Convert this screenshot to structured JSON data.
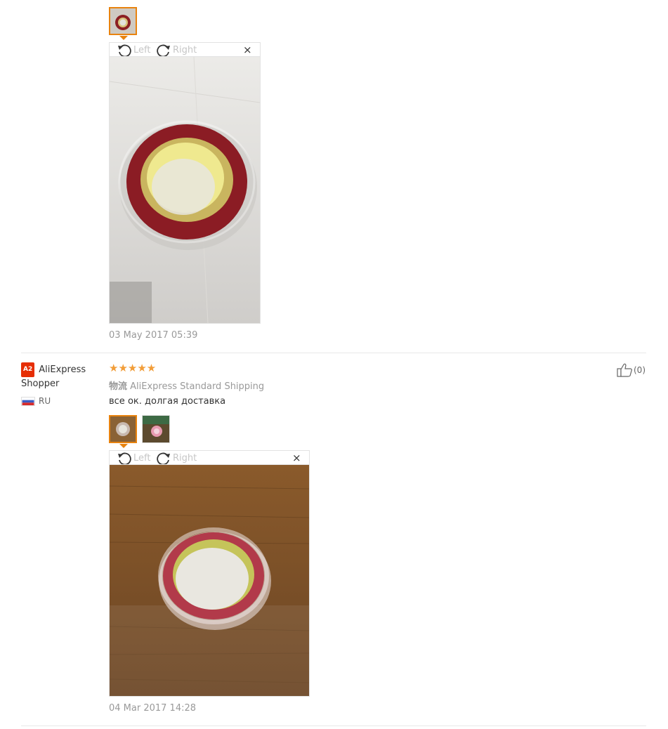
{
  "review1": {
    "thumb_count": 1,
    "toolbar": {
      "rotate_left_label": "Left",
      "rotate_right_label": "Right",
      "close_label": "×"
    },
    "date": "03 May 2017 05:39"
  },
  "review2": {
    "user": {
      "badge": "A2",
      "name": "AliExpress Shopper",
      "country": "RU"
    },
    "rating": 5,
    "stars": "★★★★★",
    "shipping_prefix": "物流",
    "shipping_method": "AliExpress Standard Shipping",
    "text": "все ок. долгая доставка",
    "helpful_count": "(0)",
    "toolbar": {
      "rotate_left_label": "Left",
      "rotate_right_label": "Right",
      "close_label": "×"
    },
    "date": "04 Mar 2017 14:28"
  },
  "colors": {
    "accent_orange": "#e8830f",
    "star_color": "#f29d38",
    "badge_red": "#e62e04"
  },
  "icons": {
    "rotate_left": "rotate-left-icon",
    "rotate_right": "rotate-right-icon",
    "close": "close-icon",
    "thumb_up": "thumbs-up-icon",
    "flag": "russia-flag-icon"
  }
}
